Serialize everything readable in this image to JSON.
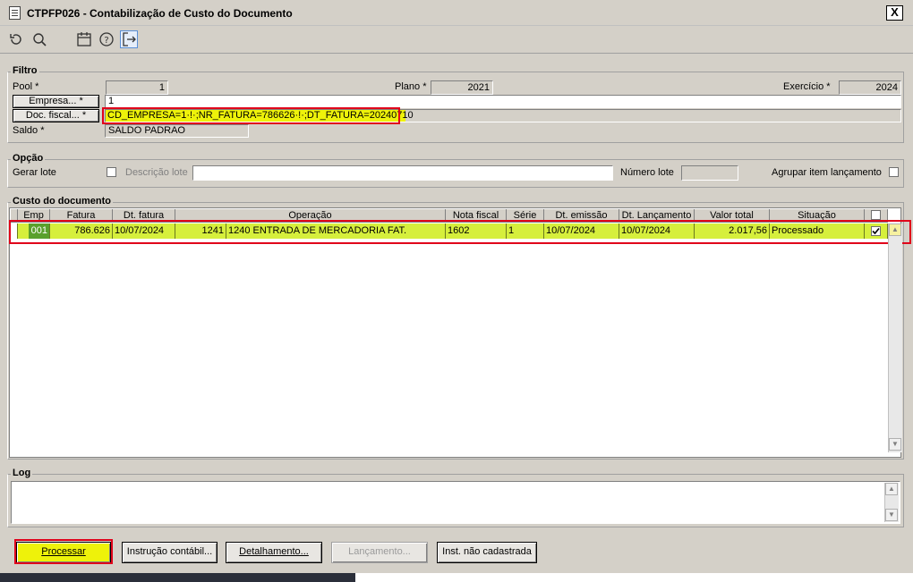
{
  "window": {
    "title": "CTPFP026 - Contabilização de Custo do Documento",
    "close_label": "X"
  },
  "toolbar": {
    "icons": [
      "undo-icon",
      "search-icon",
      "calendar-icon",
      "help-icon",
      "exit-icon"
    ]
  },
  "filtro": {
    "legend": "Filtro",
    "pool_label": "Pool *",
    "pool_value": "1",
    "plano_label": "Plano *",
    "plano_value": "2021",
    "exercicio_label": "Exercício *",
    "exercicio_value": "2024",
    "empresa_button": "Empresa... *",
    "empresa_value": "1",
    "doc_fiscal_button": "Doc. fiscal... *",
    "doc_fiscal_value": "CD_EMPRESA=1·!·;NR_FATURA=786626·!·;DT_FATURA=20240710",
    "saldo_label": "Saldo *",
    "saldo_value": "SALDO PADRAO"
  },
  "opcao": {
    "legend": "Opção",
    "gerar_lote_label": "Gerar lote",
    "descricao_lote_label": "Descrição lote",
    "descricao_lote_value": "",
    "numero_lote_label": "Número lote",
    "numero_lote_value": "",
    "agrupar_label": "Agrupar item lançamento"
  },
  "custo": {
    "legend": "Custo do documento",
    "columns": [
      "Emp",
      "Fatura",
      "Dt. fatura",
      "Operação",
      "Nota fiscal",
      "Série",
      "Dt. emissão",
      "Dt. Lançamento",
      "Valor total",
      "Situação"
    ],
    "rows": [
      {
        "emp": "001",
        "fatura": "786.626",
        "dt_fatura": "10/07/2024",
        "op_code": "1241",
        "operacao": "1240 ENTRADA DE MERCADORIA FAT.",
        "nota_fiscal": "1602",
        "serie": "1",
        "dt_emissao": "10/07/2024",
        "dt_lancamento": "10/07/2024",
        "valor_total": "2.017,56",
        "situacao": "Processado",
        "checked": true
      }
    ]
  },
  "log": {
    "legend": "Log",
    "value": ""
  },
  "buttons": {
    "processar": "Processar",
    "instrucao": "Instrução contábil...",
    "detalhamento": "Detalhamento...",
    "lancamento": "Lançamento...",
    "inst_nao_cadastrada": "Inst. não cadastrada"
  },
  "colors": {
    "highlight": "#d6ef3c",
    "annotation": "#e0001a",
    "yellow": "#eef20a"
  }
}
